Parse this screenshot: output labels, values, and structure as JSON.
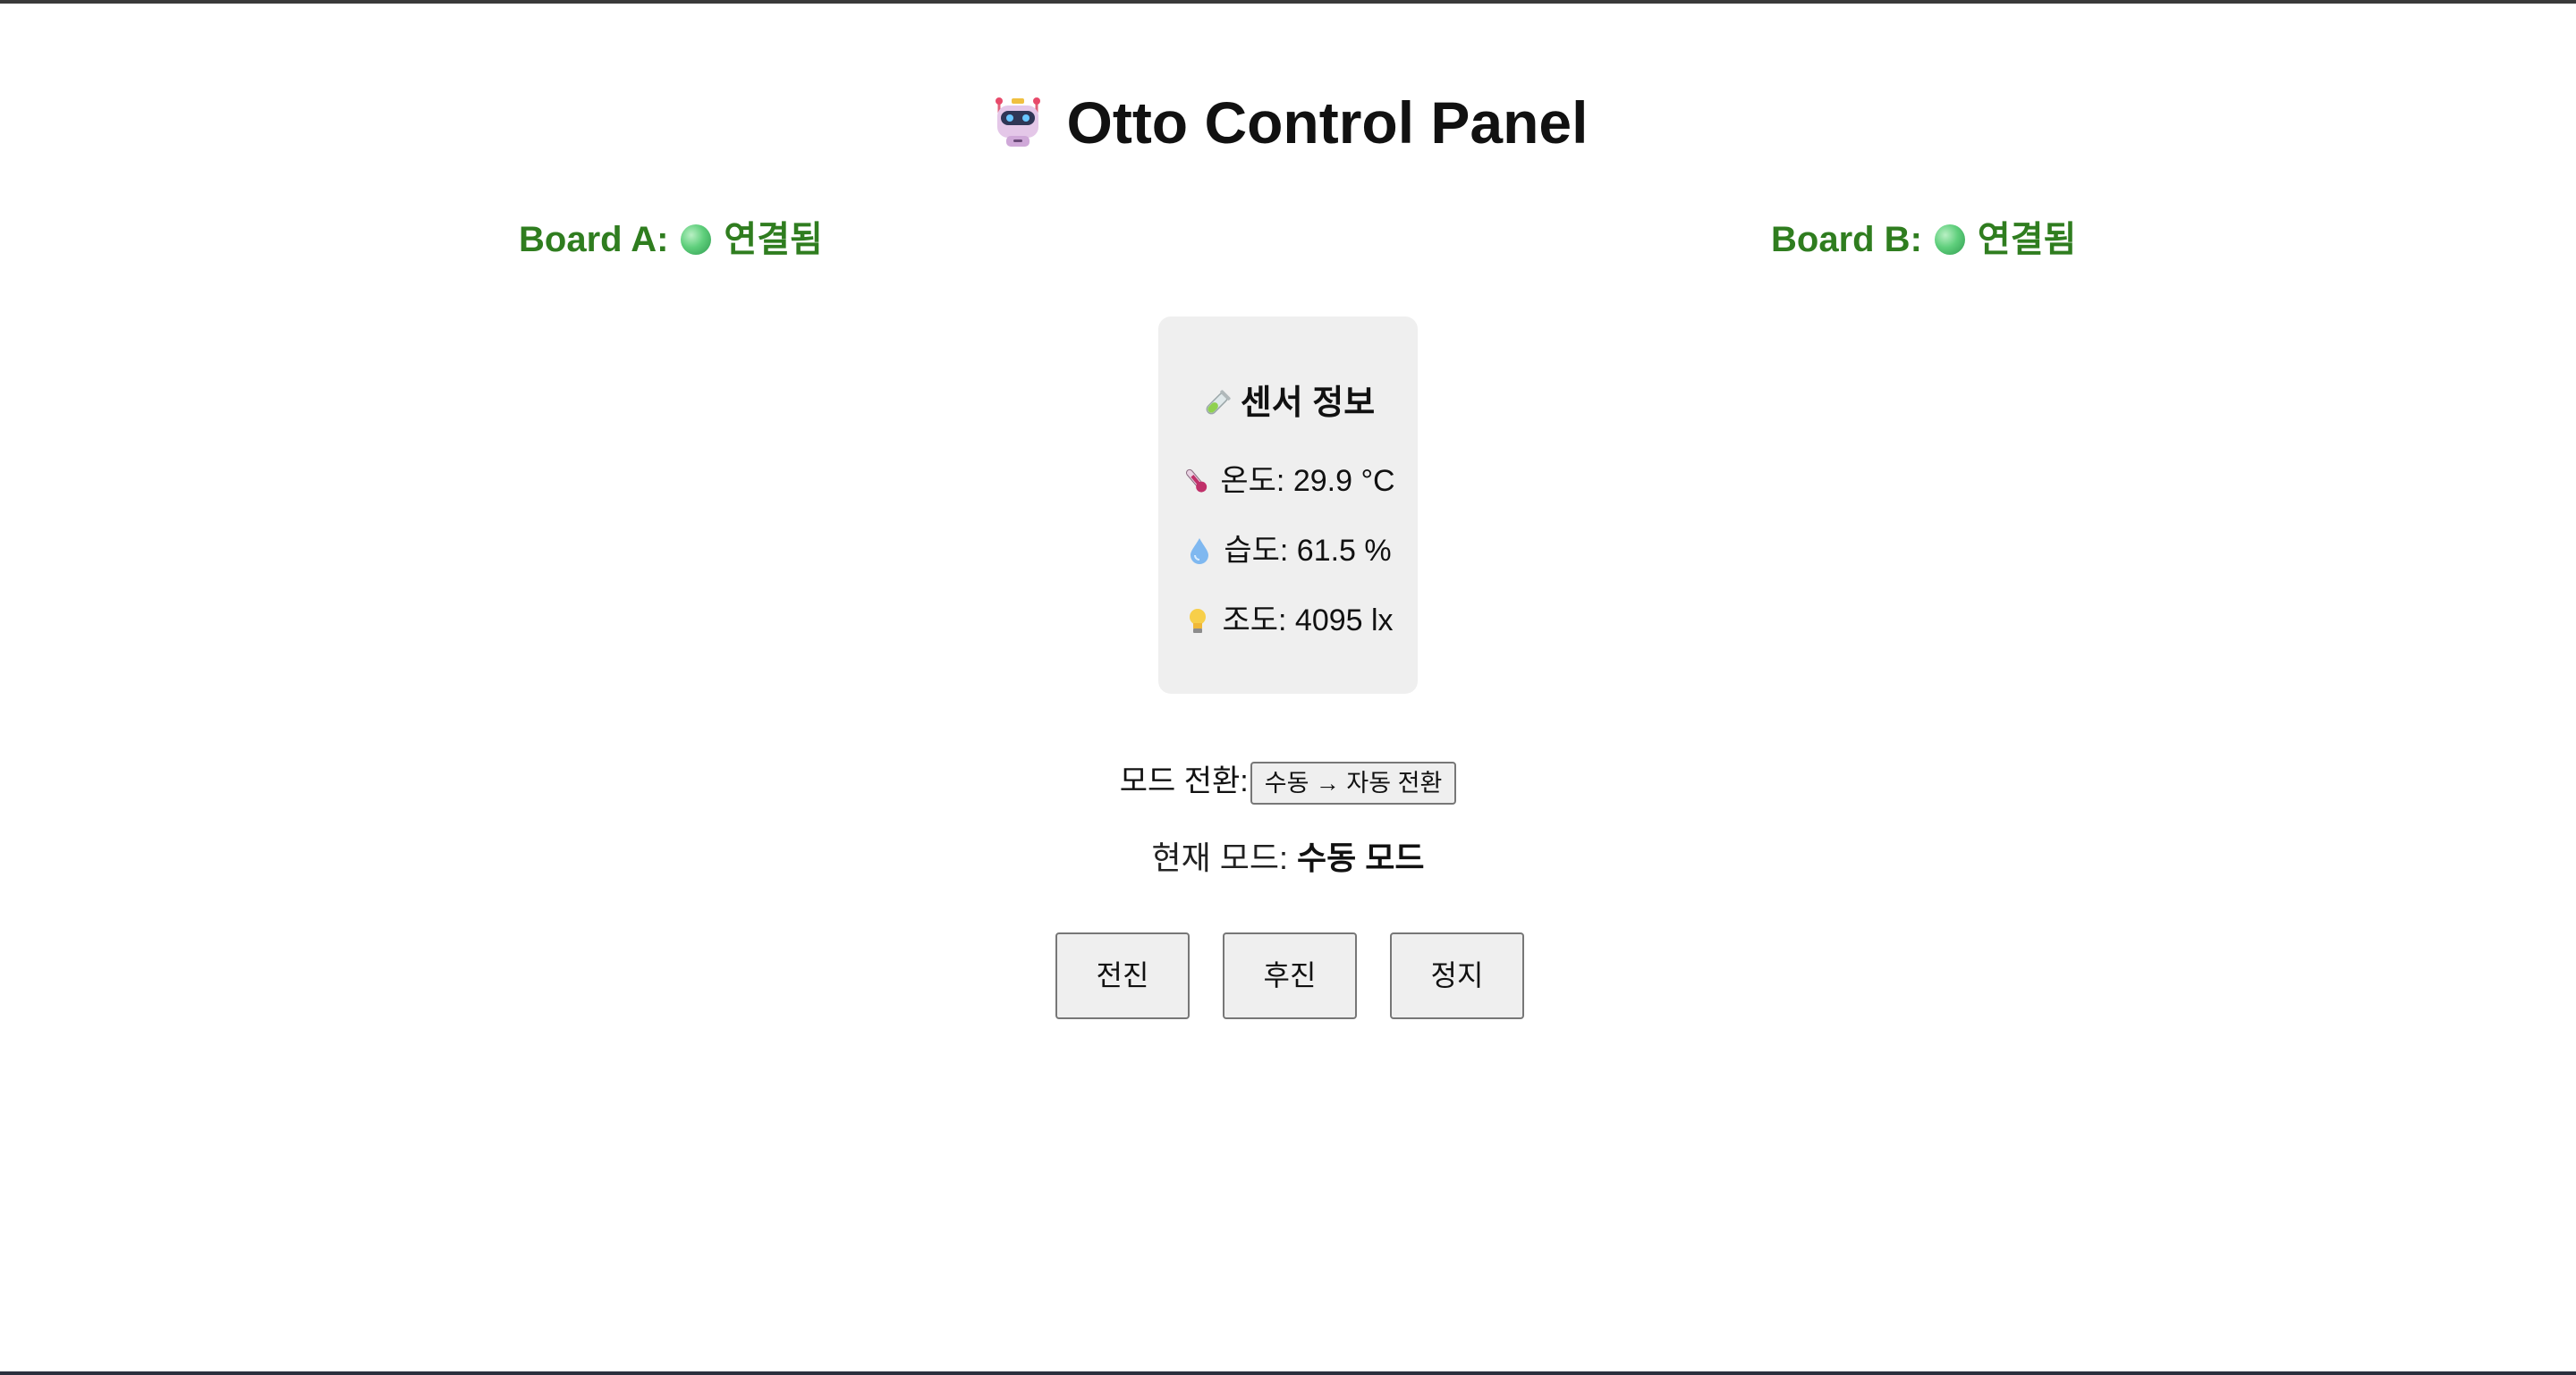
{
  "header": {
    "title": "Otto Control Panel",
    "title_icon": "robot-icon"
  },
  "boards": [
    {
      "label": "Board A:",
      "status": "연결됨",
      "status_color": "#2f7d1f",
      "indicator": "green-circle-icon"
    },
    {
      "label": "Board B:",
      "status": "연결됨",
      "status_color": "#2f7d1f",
      "indicator": "green-circle-icon"
    }
  ],
  "sensor": {
    "title": "센서 정보",
    "title_icon": "test-tube-icon",
    "temperature": {
      "label": "온도: 29.9 °C",
      "icon": "thermometer-icon"
    },
    "humidity": {
      "label": "습도: 61.5 %",
      "icon": "droplet-icon"
    },
    "illuminance": {
      "label": "조도: 4095 lx",
      "icon": "light-bulb-icon"
    }
  },
  "mode": {
    "switch_label": "모드 전환:",
    "switch_button": "수동 → 자동 전환",
    "current_label": "현재 모드:",
    "current_value": "수동 모드"
  },
  "controls": {
    "forward": "전진",
    "backward": "후진",
    "stop": "정지"
  },
  "colors": {
    "accent_green": "#2f7d1f",
    "card_background": "#efefef"
  }
}
